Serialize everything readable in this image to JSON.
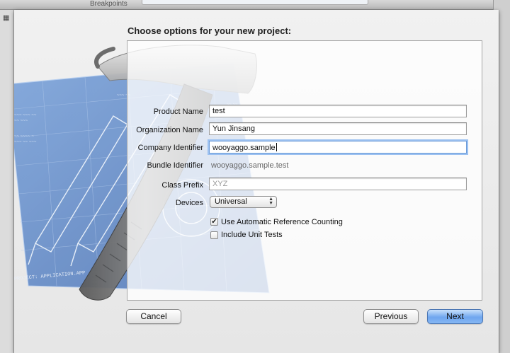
{
  "background_window": {
    "toolbar_label": "Breakpoints"
  },
  "sheet": {
    "heading": "Choose options for your new project:",
    "fields": {
      "product_name": {
        "label": "Product Name",
        "value": "test"
      },
      "organization_name": {
        "label": "Organization Name",
        "value": "Yun Jinsang"
      },
      "company_identifier": {
        "label": "Company Identifier",
        "value": "wooyaggo.sample"
      },
      "bundle_identifier": {
        "label": "Bundle Identifier",
        "value": "wooyaggo.sample.test"
      },
      "class_prefix": {
        "label": "Class Prefix",
        "placeholder": "XYZ"
      },
      "devices": {
        "label": "Devices",
        "selected": "Universal"
      }
    },
    "options": {
      "arc": {
        "label": "Use Automatic Reference Counting",
        "checked": true
      },
      "unit_tests": {
        "label": "Include Unit Tests",
        "checked": false
      }
    },
    "buttons": {
      "cancel": "Cancel",
      "previous": "Previous",
      "next": "Next"
    },
    "artwork": {
      "blueprint_footer": "PROJECT: APPLICATION.APP"
    }
  },
  "colors": {
    "blueprint": "#3f6fb8",
    "primary_button": "#6fa6ef",
    "focus_ring": "#9cc1f1"
  }
}
